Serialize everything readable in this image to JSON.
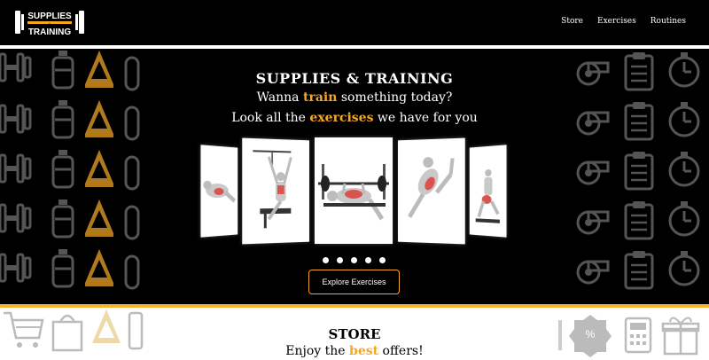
{
  "nav": {
    "logo_text_top": "SUPPLIES",
    "logo_text_mid": "&",
    "logo_text_bottom": "TRAINING",
    "links": [
      "Store",
      "Exercises",
      "Routines"
    ]
  },
  "hero": {
    "title": "SUPPLIES & TRAINING",
    "line1_pre": "Wanna ",
    "line1_hl": "train",
    "line1_post": " something today?",
    "line2_pre": "Look all the ",
    "line2_hl": "exercises",
    "line2_post": " we have for you",
    "carousel_dots": 5,
    "explore_label": "Explore Exercises"
  },
  "store": {
    "title": "STORE",
    "sub_pre": "Enjoy the ",
    "sub_hl": "best",
    "sub_post": " offers!"
  },
  "colors": {
    "accent": "#f5a623",
    "yellow_bar": "#f5b52e",
    "background": "#000000"
  }
}
